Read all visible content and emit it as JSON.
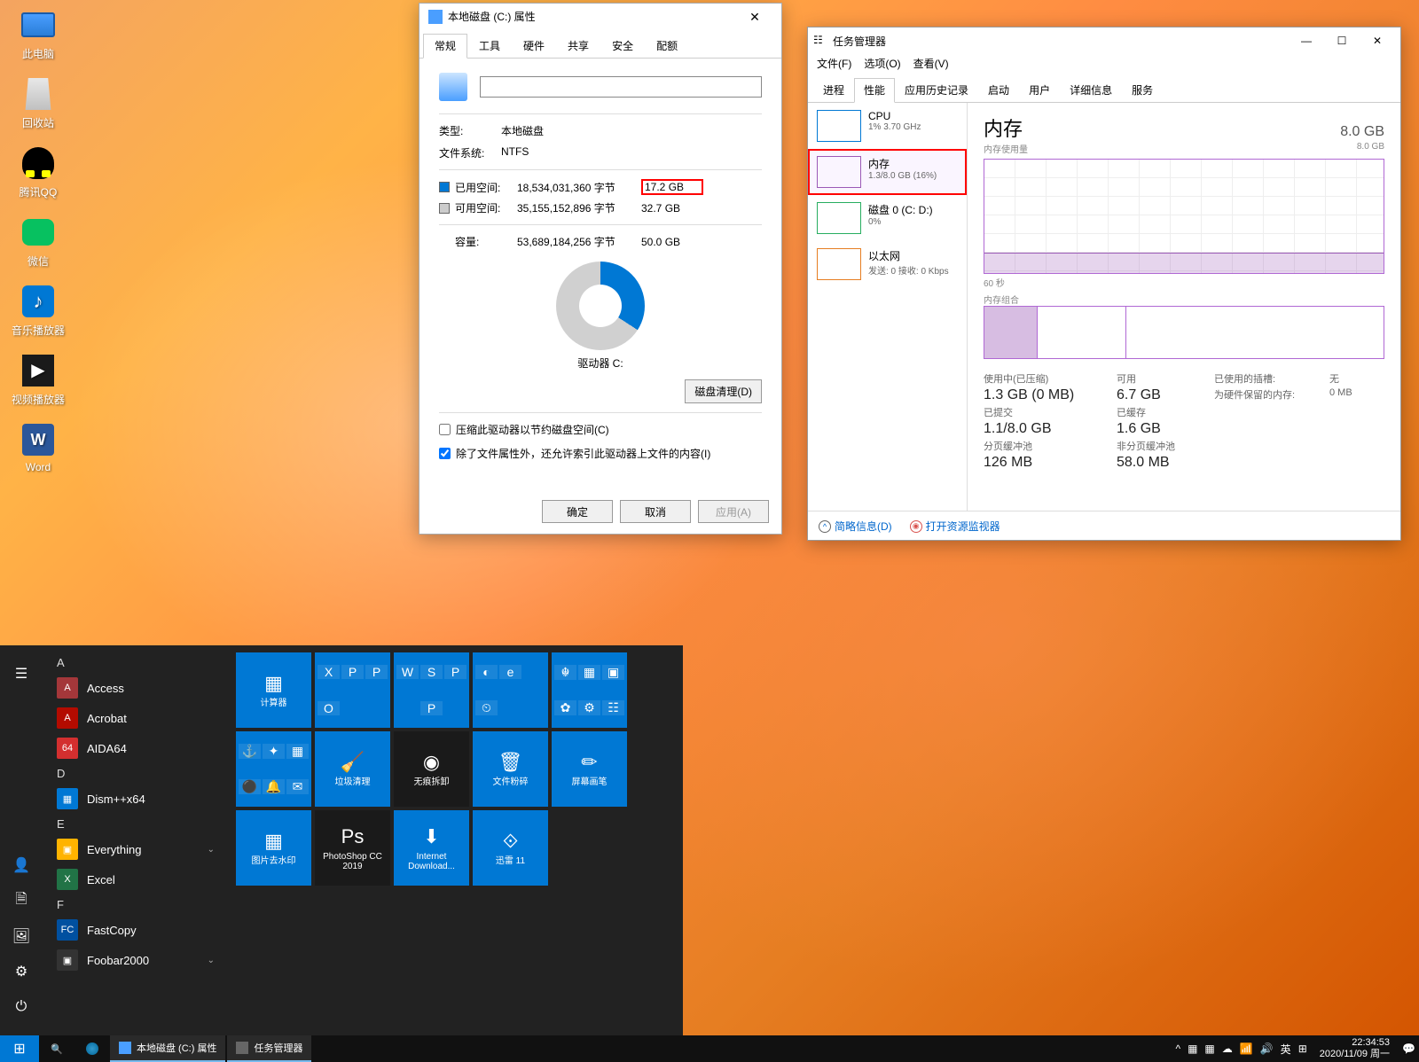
{
  "desktop": {
    "icons": [
      {
        "name": "此电脑",
        "cls": "ico-pc"
      },
      {
        "name": "回收站",
        "cls": "ico-bin"
      },
      {
        "name": "腾讯QQ",
        "cls": "ico-qq"
      },
      {
        "name": "微信",
        "cls": "ico-wx"
      },
      {
        "name": "音乐播放器",
        "cls": "ico-music",
        "glyph": "♪"
      },
      {
        "name": "视频播放器",
        "cls": "ico-video",
        "glyph": "▶"
      },
      {
        "name": "Word",
        "cls": "ico-word",
        "glyph": "W"
      }
    ]
  },
  "props": {
    "title": "本地磁盘 (C:) 属性",
    "tabs": [
      "常规",
      "工具",
      "硬件",
      "共享",
      "安全",
      "配额"
    ],
    "type_lbl": "类型:",
    "type_val": "本地磁盘",
    "fs_lbl": "文件系统:",
    "fs_val": "NTFS",
    "used_lbl": "已用空间:",
    "used_bytes": "18,534,031,360 字节",
    "used_gb": "17.2 GB",
    "free_lbl": "可用空间:",
    "free_bytes": "35,155,152,896 字节",
    "free_gb": "32.7 GB",
    "cap_lbl": "容量:",
    "cap_bytes": "53,689,184,256 字节",
    "cap_gb": "50.0 GB",
    "drive_lbl": "驱动器 C:",
    "clean_btn": "磁盘清理(D)",
    "chk1": "压缩此驱动器以节约磁盘空间(C)",
    "chk2": "除了文件属性外，还允许索引此驱动器上文件的内容(I)",
    "ok": "确定",
    "cancel": "取消",
    "apply": "应用(A)"
  },
  "tm": {
    "title": "任务管理器",
    "menu": [
      "文件(F)",
      "选项(O)",
      "查看(V)"
    ],
    "tabs": [
      "进程",
      "性能",
      "应用历史记录",
      "启动",
      "用户",
      "详细信息",
      "服务"
    ],
    "left": [
      {
        "name": "CPU",
        "sub": "1%  3.70 GHz",
        "cls": ""
      },
      {
        "name": "内存",
        "sub": "1.3/8.0 GB (16%)",
        "cls": "mem",
        "sel": true
      },
      {
        "name": "磁盘 0 (C: D:)",
        "sub": "0%",
        "cls": "disk"
      },
      {
        "name": "以太网",
        "sub": "发送: 0  接收: 0 Kbps",
        "cls": "net"
      }
    ],
    "hdr": "内存",
    "cap": "8.0 GB",
    "sub_l": "内存使用量",
    "sub_r": "8.0 GB",
    "sixty": "60 秒",
    "comp_lbl": "内存组合",
    "stats": {
      "inuse_lbl": "使用中(已压缩)",
      "inuse_val": "1.3 GB (0 MB)",
      "avail_lbl": "可用",
      "avail_val": "6.7 GB",
      "slot_lbl": "已使用的插槽:",
      "slot_val": "无",
      "hw_lbl": "为硬件保留的内存:",
      "hw_val": "0 MB",
      "commit_lbl": "已提交",
      "commit_val": "1.1/8.0 GB",
      "cache_lbl": "已缓存",
      "cache_val": "1.6 GB",
      "pp_lbl": "分页缓冲池",
      "pp_val": "126 MB",
      "np_lbl": "非分页缓冲池",
      "np_val": "58.0 MB"
    },
    "brief": "简略信息(D)",
    "resmon": "打开资源监视器"
  },
  "start": {
    "letters": {
      "A": "A",
      "D": "D",
      "E": "E",
      "F": "F"
    },
    "apps": [
      {
        "grp": "A",
        "name": "Access",
        "bg": "#a4373a",
        "txt": "A"
      },
      {
        "grp": "A",
        "name": "Acrobat",
        "bg": "#b30b00",
        "txt": "A"
      },
      {
        "grp": "A",
        "name": "AIDA64",
        "bg": "#d32f2f",
        "txt": "64"
      },
      {
        "grp": "D",
        "name": "Dism++x64",
        "bg": "#0078d4",
        "txt": "▦"
      },
      {
        "grp": "E",
        "name": "Everything",
        "bg": "#ffb300",
        "txt": "▣",
        "chev": true
      },
      {
        "grp": "E",
        "name": "Excel",
        "bg": "#217346",
        "txt": "X"
      },
      {
        "grp": "F",
        "name": "FastCopy",
        "bg": "#0050a0",
        "txt": "FC"
      },
      {
        "grp": "F",
        "name": "Foobar2000",
        "bg": "#333",
        "txt": "▣",
        "chev": true
      }
    ],
    "tiles": [
      {
        "type": "med",
        "label": "计算器",
        "icon": "▦"
      },
      {
        "type": "group",
        "cells": [
          "X",
          "P",
          "P",
          "O",
          "",
          ""
        ]
      },
      {
        "type": "group",
        "cells": [
          "W",
          "S",
          "P",
          "",
          "P",
          ""
        ]
      },
      {
        "type": "group",
        "cells": [
          "◐",
          "e",
          "",
          "⏲",
          "",
          ""
        ]
      },
      {
        "type": "group",
        "cells": [
          "☬",
          "▦",
          "▣",
          "✿",
          "⚙",
          "☷"
        ]
      },
      {
        "type": "group",
        "cells": [
          "⚓",
          "✦",
          "▦",
          "⚫",
          "🔔",
          "✉"
        ]
      },
      {
        "type": "med",
        "label": "垃圾清理",
        "icon": "🧹"
      },
      {
        "type": "med",
        "label": "无痕拆卸",
        "icon": "◉",
        "dark": true
      },
      {
        "type": "med",
        "label": "文件粉碎",
        "icon": "🗑"
      },
      {
        "type": "med",
        "label": "屏幕画笔",
        "icon": "✏"
      },
      {
        "type": "med",
        "label": "图片去水印",
        "icon": "▦"
      },
      {
        "type": "med",
        "label": "PhotoShop CC 2019",
        "icon": "Ps",
        "dark": true
      },
      {
        "type": "med",
        "label": "Internet Download...",
        "icon": "⬇"
      },
      {
        "type": "med",
        "label": "迅雷 11",
        "icon": "⟐"
      }
    ]
  },
  "taskbar": {
    "tasks": [
      {
        "label": "本地磁盘 (C:) 属性",
        "ico": "#4a9eff"
      },
      {
        "label": "任务管理器",
        "ico": "#666"
      }
    ],
    "tray": [
      "^",
      "▦",
      "▦",
      "☁",
      "📶",
      "🔊"
    ],
    "ime1": "英",
    "ime2": "⊞",
    "time": "22:34:53",
    "date": "2020/11/09 周一"
  }
}
